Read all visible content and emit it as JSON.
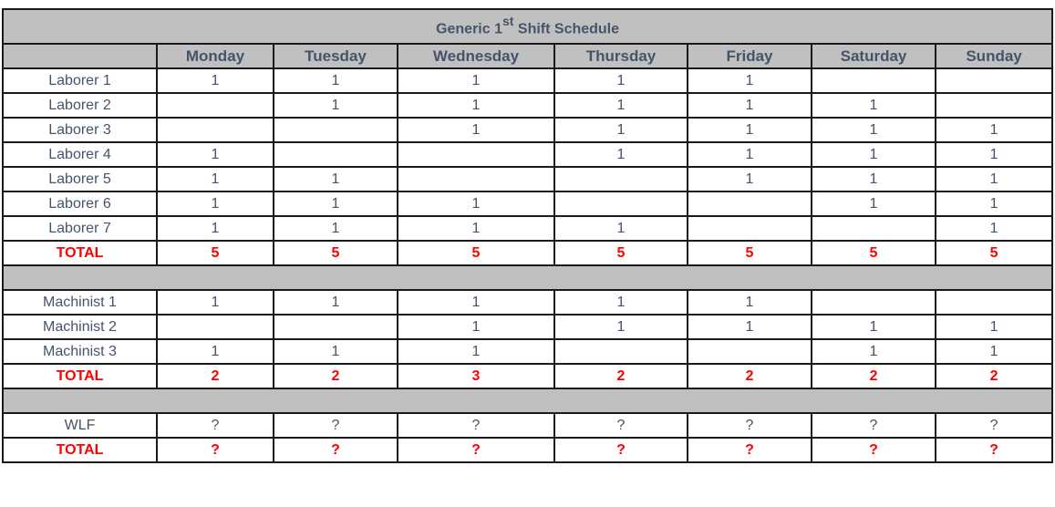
{
  "title": {
    "main": "Generic 1",
    "sup": "st",
    "rest": " Shift Schedule"
  },
  "days": [
    "Monday",
    "Tuesday",
    "Wednesday",
    "Thursday",
    "Friday",
    "Saturday",
    "Sunday"
  ],
  "sections": [
    {
      "rows": [
        {
          "label": "Laborer 1",
          "values": [
            "1",
            "1",
            "1",
            "1",
            "1",
            "",
            ""
          ]
        },
        {
          "label": "Laborer 2",
          "values": [
            "",
            "1",
            "1",
            "1",
            "1",
            "1",
            ""
          ]
        },
        {
          "label": "Laborer 3",
          "values": [
            "",
            "",
            "1",
            "1",
            "1",
            "1",
            "1"
          ]
        },
        {
          "label": "Laborer 4",
          "values": [
            "1",
            "",
            "",
            "1",
            "1",
            "1",
            "1"
          ]
        },
        {
          "label": "Laborer 5",
          "values": [
            "1",
            "1",
            "",
            "",
            "1",
            "1",
            "1"
          ]
        },
        {
          "label": "Laborer 6",
          "values": [
            "1",
            "1",
            "1",
            "",
            "",
            "1",
            "1"
          ]
        },
        {
          "label": "Laborer 7",
          "values": [
            "1",
            "1",
            "1",
            "1",
            "",
            "",
            "1"
          ]
        }
      ],
      "total": {
        "label": "TOTAL",
        "values": [
          "5",
          "5",
          "5",
          "5",
          "5",
          "5",
          "5"
        ]
      }
    },
    {
      "rows": [
        {
          "label": "Machinist 1",
          "values": [
            "1",
            "1",
            "1",
            "1",
            "1",
            "",
            ""
          ]
        },
        {
          "label": "Machinist 2",
          "values": [
            "",
            "",
            "1",
            "1",
            "1",
            "1",
            "1"
          ]
        },
        {
          "label": "Machinist 3",
          "values": [
            "1",
            "1",
            "1",
            "",
            "",
            "1",
            "1"
          ]
        }
      ],
      "total": {
        "label": "TOTAL",
        "values": [
          "2",
          "2",
          "3",
          "2",
          "2",
          "2",
          "2"
        ]
      }
    },
    {
      "rows": [
        {
          "label": "WLF",
          "values": [
            "?",
            "?",
            "?",
            "?",
            "?",
            "?",
            "?"
          ]
        }
      ],
      "total": {
        "label": "TOTAL",
        "values": [
          "?",
          "?",
          "?",
          "?",
          "?",
          "?",
          "?"
        ]
      }
    }
  ]
}
